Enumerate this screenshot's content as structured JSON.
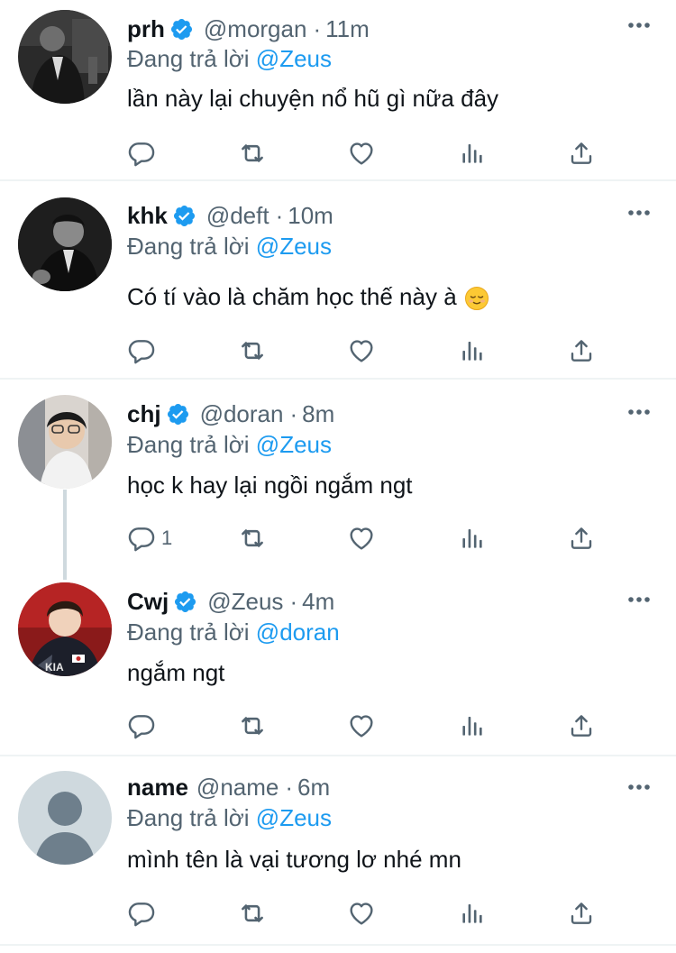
{
  "tweets": [
    {
      "name": "prh",
      "verified": true,
      "handle": "@morgan",
      "time": "11m",
      "reply_prefix": "Đang trả lời",
      "reply_to": "@Zeus",
      "text": "lần này lại chuyện nổ hũ gì nữa đây",
      "reply_count": ""
    },
    {
      "name": "khk",
      "verified": true,
      "handle": "@deft",
      "time": "10m",
      "reply_prefix": "Đang trả lời",
      "reply_to": "@Zeus",
      "text": "Có tí vào là chăm học thế này à",
      "emoji": "relieved-face-emoji",
      "reply_count": ""
    },
    {
      "name": "chj",
      "verified": true,
      "handle": "@doran",
      "time": "8m",
      "reply_prefix": "Đang trả lời",
      "reply_to": "@Zeus",
      "text": "học k hay lại ngồi ngắm ngt",
      "reply_count": "1"
    },
    {
      "name": "Cwj",
      "verified": true,
      "handle": "@Zeus",
      "time": "4m",
      "reply_prefix": "Đang trả lời",
      "reply_to": "@doran",
      "text": "ngắm ngt",
      "reply_count": ""
    },
    {
      "name": "name",
      "verified": false,
      "handle": "@name",
      "time": "6m",
      "reply_prefix": "Đang trả lời",
      "reply_to": "@Zeus",
      "text": "mình tên là vại tương lơ nhé mn",
      "reply_count": ""
    }
  ],
  "separator": "·",
  "icons": {
    "reply": "reply-icon",
    "retweet": "retweet-icon",
    "like": "heart-icon",
    "views": "views-icon",
    "share": "share-icon",
    "more": "more-icon",
    "verified": "verified-badge-icon"
  },
  "colors": {
    "text": "#0f1419",
    "secondary": "#536471",
    "accent": "#1d9bf0",
    "divider": "#eff3f4",
    "thread_line": "#cfd9de"
  }
}
